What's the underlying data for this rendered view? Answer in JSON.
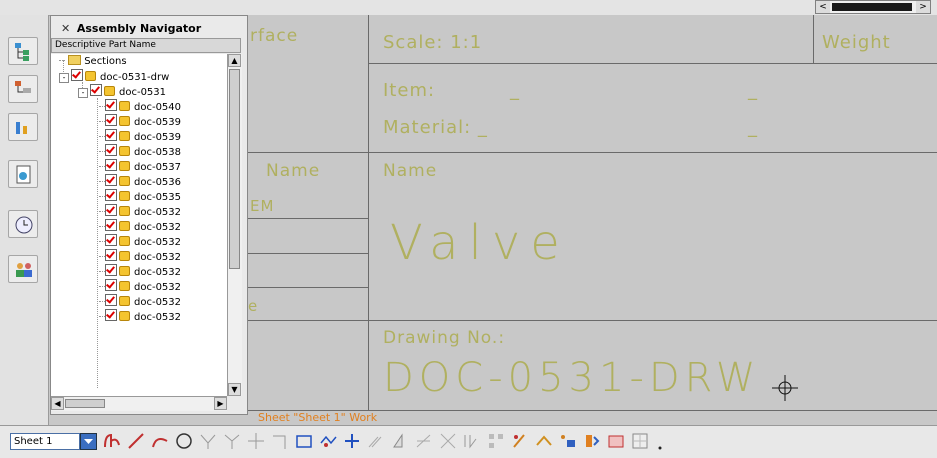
{
  "navigator": {
    "title": "Assembly Navigator",
    "column_header": "Descriptive Part Name",
    "tree": [
      {
        "label": "Sections",
        "level": 0,
        "type": "folder"
      },
      {
        "label": "doc-0531-drw",
        "level": 0,
        "type": "assembly"
      },
      {
        "label": "doc-0531",
        "level": 1,
        "type": "assembly"
      },
      {
        "label": "doc-0540",
        "level": 2,
        "type": "part"
      },
      {
        "label": "doc-0539",
        "level": 2,
        "type": "part"
      },
      {
        "label": "doc-0539",
        "level": 2,
        "type": "part"
      },
      {
        "label": "doc-0538",
        "level": 2,
        "type": "part"
      },
      {
        "label": "doc-0537",
        "level": 2,
        "type": "part"
      },
      {
        "label": "doc-0536",
        "level": 2,
        "type": "part"
      },
      {
        "label": "doc-0535",
        "level": 2,
        "type": "part"
      },
      {
        "label": "doc-0532",
        "level": 2,
        "type": "part"
      },
      {
        "label": "doc-0532",
        "level": 2,
        "type": "part"
      },
      {
        "label": "doc-0532",
        "level": 2,
        "type": "part"
      },
      {
        "label": "doc-0532",
        "level": 2,
        "type": "part"
      },
      {
        "label": "doc-0532",
        "level": 2,
        "type": "part"
      },
      {
        "label": "doc-0532",
        "level": 2,
        "type": "part"
      },
      {
        "label": "doc-0532",
        "level": 2,
        "type": "part"
      },
      {
        "label": "doc-0532",
        "level": 2,
        "type": "part"
      }
    ]
  },
  "title_block": {
    "surface_fragment": "rface",
    "scale": "Scale: 1:1",
    "weight": "Weight",
    "item": "Item:",
    "item_blank": "_",
    "item_blank2": "_",
    "material": "Material: _",
    "material_blank": "_",
    "name_left": "Name",
    "em_fragment": "EM",
    "name_right": "Name",
    "part_name": "Valve",
    "e_fragment": "e",
    "drawing_no_label": "Drawing No.:",
    "drawing_no": "DOC-0531-DRW",
    "sheet_status": "Sheet \"Sheet 1\" Work"
  },
  "statusbar": {
    "sheet_value": "Sheet 1"
  },
  "colors": {
    "drawing_text": "#b0b060",
    "sheet_status": "#e08020",
    "check": "#dd0000"
  }
}
